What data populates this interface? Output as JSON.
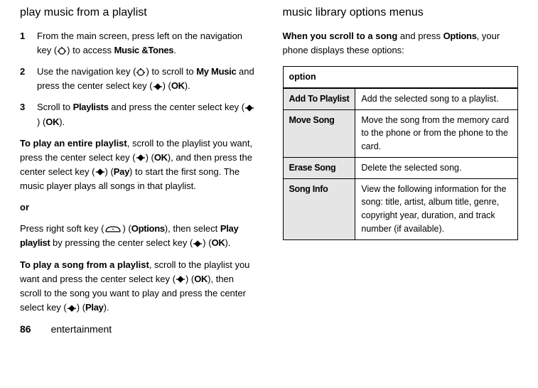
{
  "left": {
    "heading": "play music from a playlist",
    "steps": [
      {
        "num": "1",
        "pre": "From the main screen, press left on the navigation key (",
        "icon": "nav",
        "post": ") to access ",
        "bold1": "Music &Tones",
        "tail": "."
      },
      {
        "num": "2",
        "pre": "Use the navigation key (",
        "icon": "nav",
        "post": ") to scroll to ",
        "bold1": "My Music",
        "mid": " and press the center select key (",
        "icon2": "select",
        "post2": ") (",
        "bold2": "OK",
        "tail": ")."
      },
      {
        "num": "3",
        "pre": "Scroll to ",
        "bold1": "Playlists",
        "mid": " and press the center select key (",
        "icon2": "select",
        "post2": ") (",
        "bold2": "OK",
        "tail": ")."
      }
    ],
    "p1": {
      "lead": "To play an entire playlist",
      "a": ", scroll to the playlist you want, press the center select key (",
      "b": ") (",
      "ok1": "OK",
      "c": "), and then press the center select key (",
      "d": ") (",
      "pay": "Pay",
      "e": ") to start the first song. The music player plays all songs in that playlist."
    },
    "or": "or",
    "p2": {
      "a": "Press right soft key  (",
      "b": ") (",
      "opt": "Options",
      "c": "), then select ",
      "pp": "Play playlist",
      "d": " by pressing the center select key (",
      "e": ") (",
      "ok": "OK",
      "f": ")."
    },
    "p3": {
      "lead": "To play a song from a playlist",
      "a": ", scroll to the playlist you want and press the center select key (",
      "b": ") (",
      "ok": "OK",
      "c": "), then scroll to the song you want to play and press the center select key (",
      "d": ") (",
      "play": "Play",
      "e": ")."
    }
  },
  "right": {
    "heading": "music library options menus",
    "intro": {
      "lead": "When you scroll to a song",
      "a": " and press ",
      "opt": "Options",
      "b": ", your phone displays these options:"
    },
    "table": {
      "header": "option",
      "rows": [
        {
          "opt": "Add To Playlist",
          "desc": "Add the selected song to a playlist."
        },
        {
          "opt": "Move Song",
          "desc": "Move the song from the memory card to the phone or from the phone to the card."
        },
        {
          "opt": "Erase Song",
          "desc": "Delete the selected song."
        },
        {
          "opt": "Song Info",
          "desc": "View the following information for the song: title, artist, album title, genre, copyright year, duration, and track number (if available)."
        }
      ]
    }
  },
  "footer": {
    "page": "86",
    "cat": "entertainment"
  }
}
